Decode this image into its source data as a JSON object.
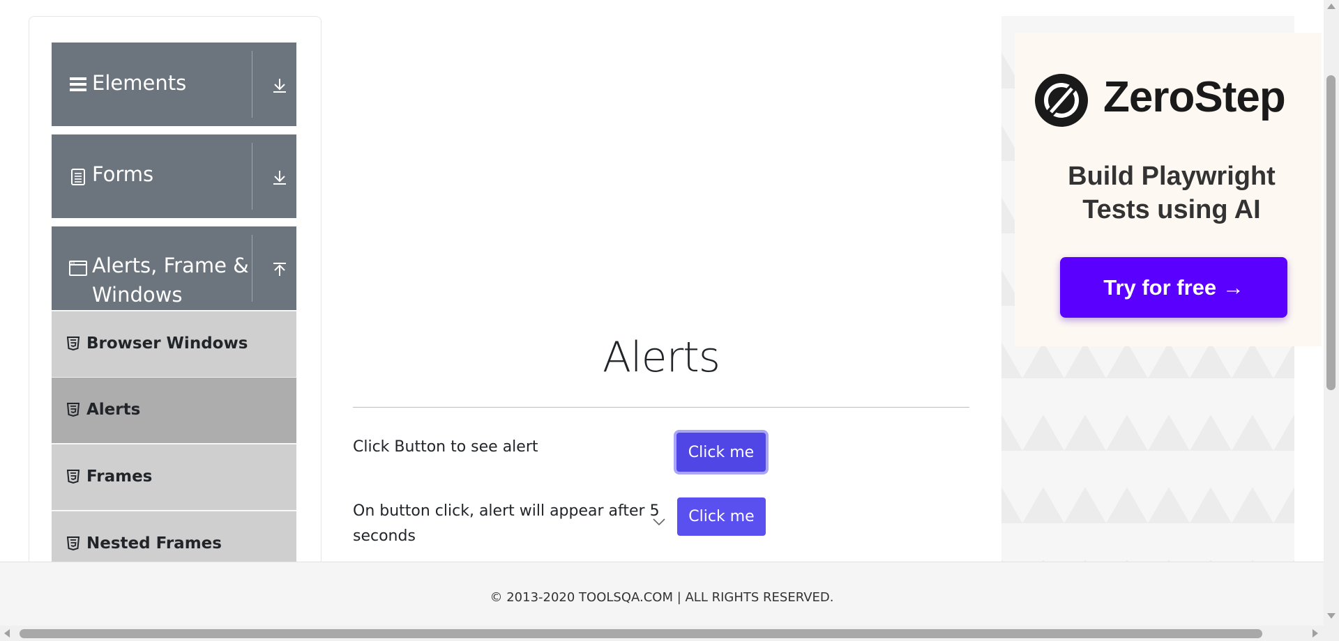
{
  "sidebar": {
    "groups": [
      {
        "label": "Elements",
        "icon": "hamburger-icon",
        "toggle": "download-arrow-icon"
      },
      {
        "label": "Forms",
        "icon": "document-icon",
        "toggle": "download-arrow-icon"
      },
      {
        "label_line1": "Alerts, Frame &",
        "label_line2": "Windows",
        "icon": "window-icon",
        "toggle": "upload-arrow-icon"
      }
    ],
    "items": [
      {
        "label": "Browser Windows",
        "icon": "html5-icon",
        "active": false
      },
      {
        "label": "Alerts",
        "icon": "html5-icon",
        "active": true
      },
      {
        "label": "Frames",
        "icon": "html5-icon",
        "active": false
      },
      {
        "label": "Nested Frames",
        "icon": "html5-icon",
        "active": false
      }
    ]
  },
  "main": {
    "title": "Alerts",
    "rows": [
      {
        "label": "Click Button to see alert",
        "button": "Click me"
      },
      {
        "label_line1": "On button click, alert will appear after 5",
        "label_line2": "seconds",
        "button": "Click me"
      }
    ]
  },
  "ad": {
    "brand": "ZeroStep",
    "tagline_line1": "Build Playwright",
    "tagline_line2": "Tests using AI",
    "cta": "Try for free →"
  },
  "footer": {
    "text": "© 2013-2020 TOOLSQA.COM | ALL RIGHTS RESERVED."
  },
  "colors": {
    "sidebar_group": "#6c757d",
    "sidebar_item": "#cfcfcf",
    "sidebar_item_active": "#adadad",
    "button": "#5a4fef",
    "ad_cta": "#5a00ff"
  }
}
